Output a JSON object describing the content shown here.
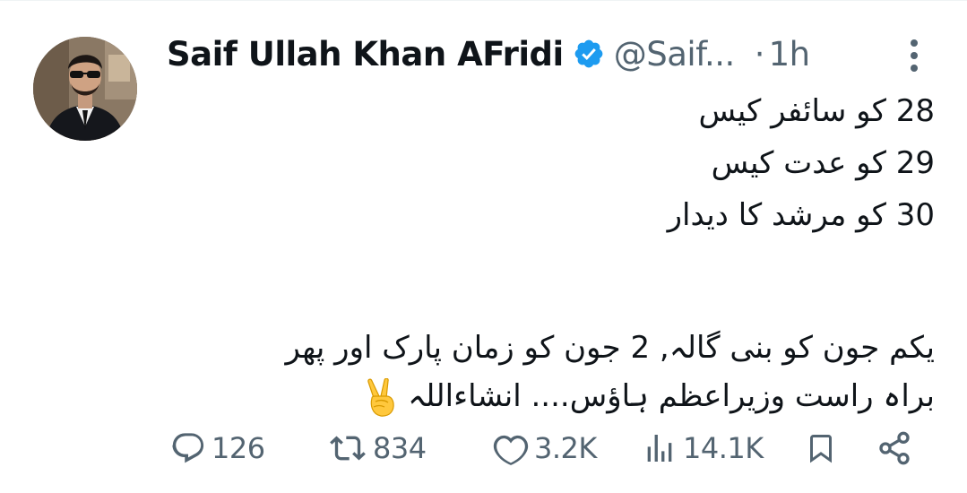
{
  "tweet": {
    "author": {
      "name": "Saif Ullah Khan AFridi",
      "handle": "@Saif...",
      "verified": true
    },
    "separator": "·",
    "time": "1h",
    "lines": [
      "28 کو سائفر کیس",
      "29 کو عدت کیس",
      "30 کو مرشد کا دیدار",
      "",
      "یکم جون کو بنی گالہ, 2 جون کو زمان پارک اور پھر",
      "براہ راست وزیراعظم ہاؤس.... انشاءاللہ"
    ],
    "emoji": "victory-hand-emoji"
  },
  "stats": {
    "replies": "126",
    "retweets": "834",
    "likes": "3.2K",
    "views": "14.1K"
  },
  "colors": {
    "text": "#0f1419",
    "muted": "#536471",
    "verified": "#1d9bf0",
    "divider": "#eff3f4"
  },
  "icons": [
    "more-icon",
    "reply-icon",
    "retweet-icon",
    "like-icon",
    "views-icon",
    "bookmark-icon",
    "share-icon",
    "verified-badge-icon"
  ]
}
